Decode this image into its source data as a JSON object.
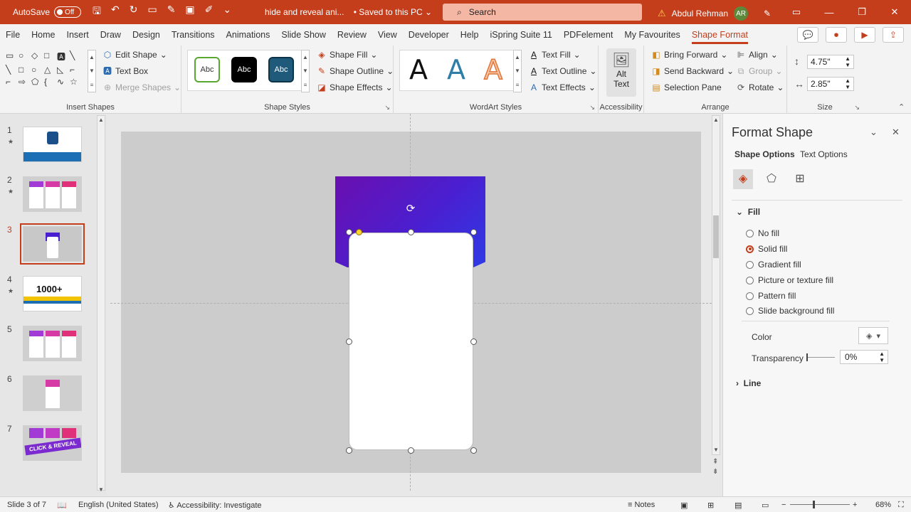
{
  "titlebar": {
    "autosave_label": "AutoSave",
    "autosave_state": "Off",
    "doc_name": "hide and reveal ani...",
    "save_status": "• Saved to this PC",
    "search_placeholder": "Search",
    "user_name": "Abdul Rehman",
    "user_initials": "AR",
    "accent": "#c43e1c"
  },
  "menu": {
    "tabs": [
      "File",
      "Home",
      "Insert",
      "Draw",
      "Design",
      "Transitions",
      "Animations",
      "Slide Show",
      "Review",
      "View",
      "Developer",
      "Help",
      "iSpring Suite 11",
      "PDFelement",
      "My Favourites",
      "Shape Format"
    ],
    "active_tab": "Shape Format"
  },
  "ribbon": {
    "insert_shapes": {
      "label": "Insert Shapes",
      "edit_shape": "Edit Shape",
      "text_box": "Text Box",
      "merge_shapes": "Merge Shapes"
    },
    "shape_styles": {
      "label": "Shape Styles",
      "preview_text": "Abc",
      "shape_fill": "Shape Fill",
      "shape_outline": "Shape Outline",
      "shape_effects": "Shape Effects"
    },
    "wordart": {
      "label": "WordArt Styles",
      "letter": "A",
      "text_fill": "Text Fill",
      "text_outline": "Text Outline",
      "text_effects": "Text Effects"
    },
    "accessibility": {
      "label": "Accessibility",
      "alt_text_line1": "Alt",
      "alt_text_line2": "Text"
    },
    "arrange": {
      "label": "Arrange",
      "bring_forward": "Bring Forward",
      "send_backward": "Send Backward",
      "selection_pane": "Selection Pane",
      "align": "Align",
      "group": "Group",
      "rotate": "Rotate"
    },
    "size": {
      "label": "Size",
      "height": "4.75\"",
      "width": "2.85\""
    }
  },
  "slides": [
    {
      "num": "1",
      "star": "★"
    },
    {
      "num": "2",
      "star": "★"
    },
    {
      "num": "3",
      "star": ""
    },
    {
      "num": "4",
      "star": "★"
    },
    {
      "num": "5",
      "star": ""
    },
    {
      "num": "6",
      "star": ""
    },
    {
      "num": "7",
      "star": ""
    }
  ],
  "thumb_texts": {
    "thumb4_big": "1000+",
    "thumb7_banner": "CLICK & REVEAL"
  },
  "pane": {
    "title": "Format Shape",
    "tab_shape": "Shape Options",
    "tab_text": "Text Options",
    "fill_head": "Fill",
    "options": [
      "No fill",
      "Solid fill",
      "Gradient fill",
      "Picture or texture fill",
      "Pattern fill",
      "Slide background fill"
    ],
    "selected": "Solid fill",
    "color_label": "Color",
    "transparency_label": "Transparency",
    "transparency_value": "0%",
    "line_head": "Line"
  },
  "status": {
    "slide_info": "Slide 3 of 7",
    "language": "English (United States)",
    "accessibility": "Accessibility: Investigate",
    "notes": "Notes",
    "zoom": "68%"
  }
}
